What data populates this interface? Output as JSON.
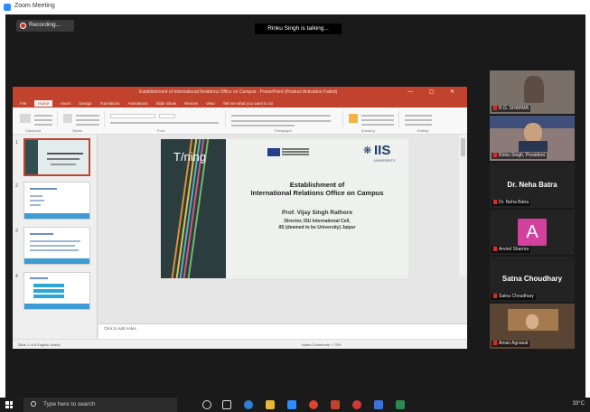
{
  "window": {
    "title": "Zoom Meeting"
  },
  "meeting": {
    "recording_label": "Recording...",
    "talking_banner": "Rinku Singh is talking..."
  },
  "ppt": {
    "title": "Establishment of International Relations Office on Campus - PowerPoint (Product Activation Failed)",
    "tabs": [
      "File",
      "Home",
      "Insert",
      "Design",
      "Transitions",
      "Animations",
      "Slide Show",
      "Review",
      "View",
      "Tell me what you want to do"
    ],
    "ribbon_groups": [
      "Clipboard",
      "Slides",
      "Font",
      "Paragraph",
      "Drawing",
      "Editing"
    ],
    "notes_placeholder": "Click to add notes",
    "status_left": "Slide 1 of 8   English (India)",
    "status_right": "Notes   Comments   +   73%",
    "slide": {
      "brand": "T/ning",
      "title_line1": "Establishment of",
      "title_line2": "International Relations Office on Campus",
      "presenter": "Prof. Vijay Singh Rathore",
      "role": "Director, ISU International Cell,",
      "org": "IIS (deemed to be University) Jaipur",
      "iis_logo": "IIS",
      "iis_sub": "UNIVERSITY"
    },
    "thumb_numbers": [
      "1",
      "2",
      "3",
      "4"
    ]
  },
  "participants": [
    {
      "label": "R.G. SHARMA"
    },
    {
      "label": "Rinku Singh, President"
    },
    {
      "big_name": "Dr. Neha Batra",
      "label": "Dr. Neha Batra"
    },
    {
      "avatar_letter": "A",
      "label": "Arvind Sharma"
    },
    {
      "big_name": "Satna Choudhary",
      "label": "Satna Choudhary"
    },
    {
      "label": "Aman Agrawal"
    }
  ],
  "taskbar": {
    "search_placeholder": "Type here to search",
    "tray_text": "33°C"
  },
  "colors": {
    "ppt_accent": "#c1432d",
    "zoom_blue": "#2d8cff",
    "avatar_pink": "#d1419d"
  }
}
